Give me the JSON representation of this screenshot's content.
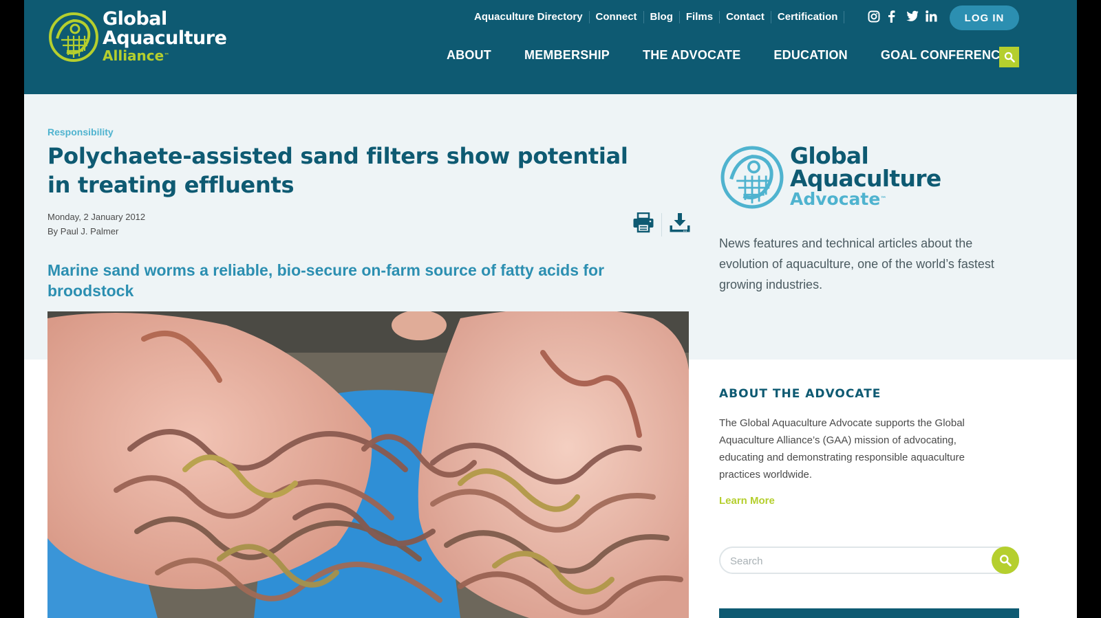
{
  "header": {
    "logo": {
      "line1": "Global",
      "line2": "Aquaculture",
      "line3": "Alliance",
      "tm": "™"
    },
    "top_links": [
      "Aquaculture Directory",
      "Connect",
      "Blog",
      "Films",
      "Contact",
      "Certification"
    ],
    "social_icons": [
      "instagram-icon",
      "facebook-icon",
      "twitter-icon",
      "linkedin-icon"
    ],
    "login_label": "LOG IN",
    "main_nav": [
      "ABOUT",
      "MEMBERSHIP",
      "THE ADVOCATE",
      "EDUCATION",
      "GOAL CONFERENCE"
    ]
  },
  "article": {
    "category": "Responsibility",
    "title": "Polychaete-assisted sand filters show potential in treating effluents",
    "date": "Monday, 2 January 2012",
    "byline": "By Paul J. Palmer",
    "subtitle": "Marine sand worms a reliable, bio-secure on-farm source of fatty acids for broodstock",
    "photo_alt": "Hands holding marine sand worms over a blue tub"
  },
  "sidebar": {
    "advocate_logo": {
      "line1": "Global",
      "line2": "Aquaculture",
      "line3": "Advocate",
      "tm": "™"
    },
    "description": "News features and technical articles about the evolution of aquaculture, one of the world’s fastest growing industries.",
    "about_heading": "ABOUT THE ADVOCATE",
    "about_text": "The Global Aquaculture Advocate supports the Global Aquaculture Alliance’s (GAA) mission of advocating, educating and demonstrating responsible aquaculture practices worldwide.",
    "learn_more": "Learn More",
    "search_placeholder": "Search"
  },
  "colors": {
    "header_bg": "#0e5a72",
    "accent_green": "#b5cf2e",
    "accent_blue": "#2c8fb1",
    "light_blue": "#4fb3cf",
    "band_bg": "#eef4f6"
  }
}
